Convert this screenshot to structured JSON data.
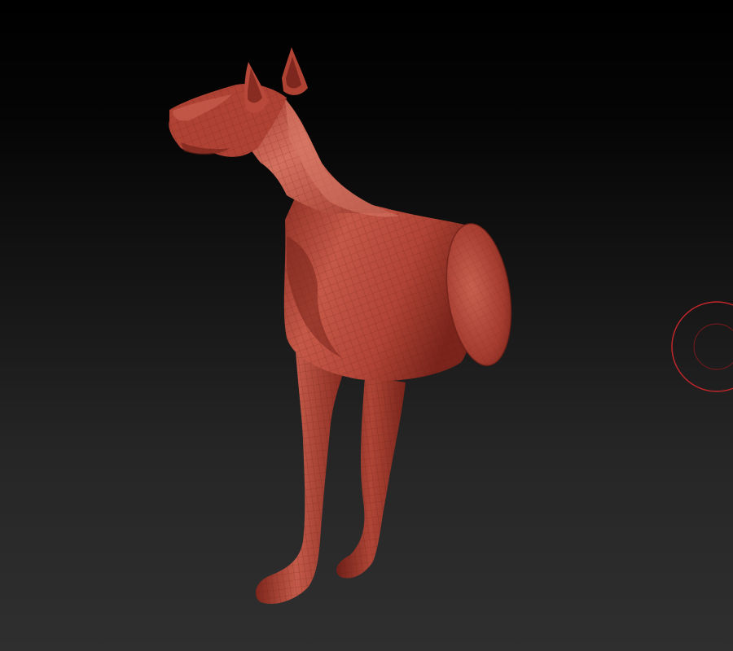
{
  "viewport": {
    "background_top": "#000000",
    "background_bottom": "#2f2f2f"
  },
  "model": {
    "subject": "dog-sculpt",
    "material_color": "#b5463a",
    "material_highlight": "#dd7e6c",
    "material_shadow": "#6f1f17",
    "wireframe_visible": true
  },
  "brush_cursor": {
    "icon": "brush-cursor-icon",
    "color": "#c0262a"
  }
}
